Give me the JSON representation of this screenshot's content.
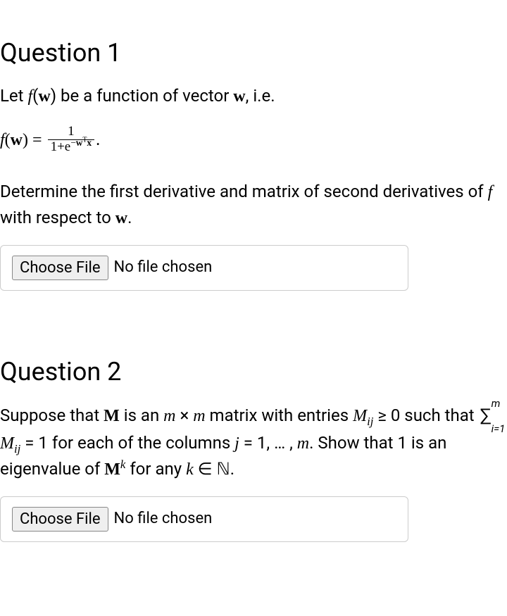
{
  "q1": {
    "heading": "Question 1",
    "intro_a": "Let ",
    "intro_b": "f",
    "intro_c": "(",
    "intro_d": "w",
    "intro_e": ")",
    "intro_f": " be a function of vector ",
    "intro_g": "w",
    "intro_h": ", i.e.",
    "formula_f": "f",
    "formula_lp": "(",
    "formula_w": "w",
    "formula_rp": ")",
    "formula_eq": " = ",
    "formula_num": "1",
    "formula_den_1": "1+e",
    "formula_den_exp_minus": "−",
    "formula_den_exp_w": "w",
    "formula_den_exp_t": "T",
    "formula_den_exp_x": "x",
    "formula_dot": ".",
    "task_a": "Determine the first derivative and matrix of second derivatives of ",
    "task_b": "f",
    "task_c": " with respect to ",
    "task_d": "w",
    "task_e": ".",
    "choose_btn": "Choose File",
    "no_file": "No file chosen"
  },
  "q2": {
    "heading": "Question 2",
    "t1": "Suppose that ",
    "t2": "M",
    "t3": " is an ",
    "t4": "m",
    "t5": " × ",
    "t6": "m",
    "t7": " matrix with entries ",
    "t8": "M",
    "t8sub": "ij",
    "t9": " ≥ 0 such that ",
    "sum_top": "m",
    "sum_bot": "i=1",
    "t10": " ",
    "t11": "M",
    "t11sub": "ij",
    "t12": " = 1 for each of the columns ",
    "t13": "j",
    "t14": " = 1, … , ",
    "t15": "m",
    "t16": ". Show that 1 is an eigenvalue of ",
    "t17": "M",
    "t17sup": "k",
    "t18": " for any ",
    "t19": "k",
    "t20": " ∈ ℕ.",
    "choose_btn": "Choose File",
    "no_file": "No file chosen"
  }
}
